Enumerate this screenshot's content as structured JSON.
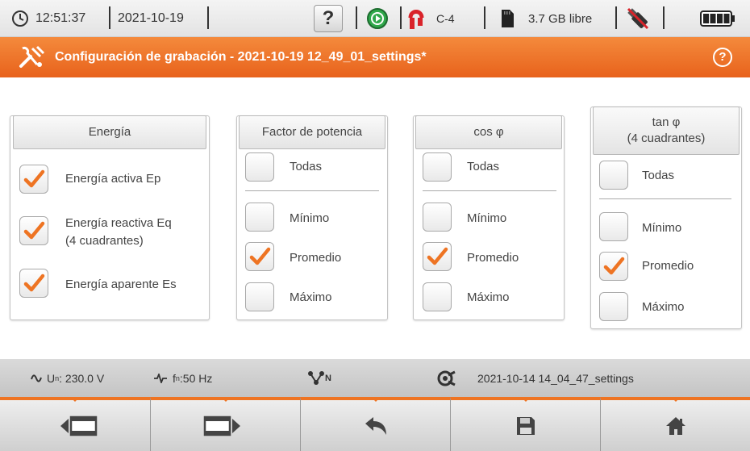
{
  "status": {
    "time": "12:51:37",
    "date": "2021-10-19",
    "help_label": "?",
    "clamp_label": "C-4",
    "storage_label": "3.7 GB libre"
  },
  "title": {
    "text": "Configuración de grabación - 2021-10-19 12_49_01_settings*",
    "help_label": "?"
  },
  "panels": {
    "energia": {
      "header": "Energía",
      "items": [
        {
          "label": "Energía activa Ep",
          "checked": true
        },
        {
          "label": "Energía reactiva Eq",
          "label2": "(4 cuadrantes)",
          "checked": true
        },
        {
          "label": "Energía aparente Es",
          "checked": true
        }
      ]
    },
    "factor": {
      "header": "Factor de potencia",
      "todas": "Todas",
      "items": [
        {
          "label": "Mínimo",
          "checked": false
        },
        {
          "label": "Promedio",
          "checked": true
        },
        {
          "label": "Máximo",
          "checked": false
        }
      ]
    },
    "cos": {
      "header": "cos φ",
      "todas": "Todas",
      "items": [
        {
          "label": "Mínimo",
          "checked": false
        },
        {
          "label": "Promedio",
          "checked": true
        },
        {
          "label": "Máximo",
          "checked": false
        }
      ]
    },
    "tan": {
      "header_line1": "tan φ",
      "header_line2": "(4 cuadrantes)",
      "todas": "Todas",
      "items": [
        {
          "label": "Mínimo",
          "checked": false
        },
        {
          "label": "Promedio",
          "checked": true
        },
        {
          "label": "Máximo",
          "checked": false
        }
      ]
    }
  },
  "info": {
    "voltage_prefix": "U",
    "voltage_sub": "n",
    "voltage_value": ": 230.0 V",
    "freq_prefix": "f",
    "freq_sub": "n",
    "freq_value": ":50 Hz",
    "network_sub": "N",
    "settings_file": "2021-10-14 14_04_47_settings"
  },
  "colors": {
    "accent": "#ee7423",
    "check": "#ee7423",
    "title_bg": "#e8621c"
  },
  "icons": [
    "clock-icon",
    "help-icon",
    "play-circle-icon",
    "clamp-icon",
    "sd-card-icon",
    "usb-off-icon",
    "battery-icon",
    "tools-icon",
    "sine-wave-icon",
    "frequency-icon",
    "network-type-icon",
    "settings-file-icon",
    "prev-screen-icon",
    "next-screen-icon",
    "back-icon",
    "save-icon",
    "home-icon"
  ]
}
